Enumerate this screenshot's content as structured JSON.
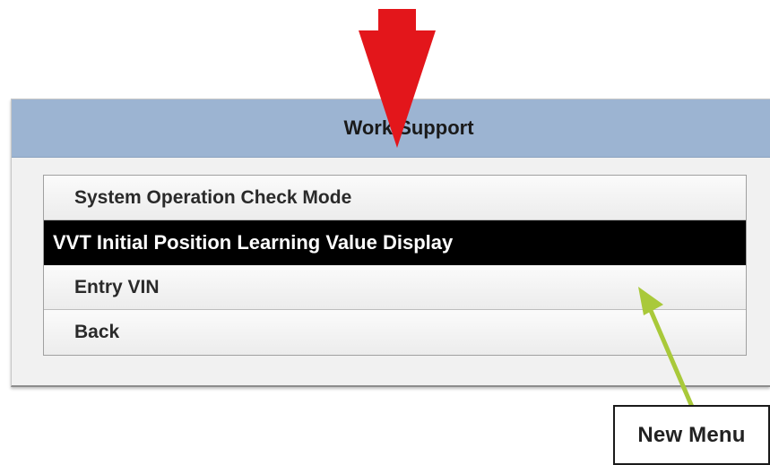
{
  "dialog": {
    "title": "Work Support",
    "header_color": "#9cb4d2",
    "menu_items": [
      {
        "label": "System Operation Check Mode",
        "selected": false
      },
      {
        "label": "VVT Initial Position Learning Value Display",
        "selected": true
      },
      {
        "label": "Entry VIN",
        "selected": false
      },
      {
        "label": "Back",
        "selected": false
      }
    ]
  },
  "annotations": {
    "red_arrow_color": "#e3161b",
    "green_arrow_color": "#a9c93a",
    "callout_label": "New Menu"
  }
}
